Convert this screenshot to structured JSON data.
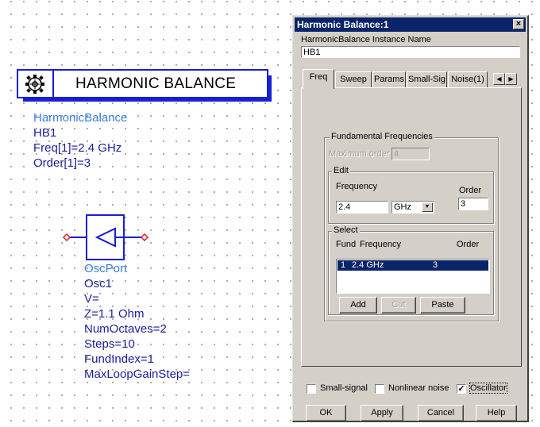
{
  "schematic": {
    "hb_title": "HARMONIC BALANCE",
    "hb_component": {
      "name": "HarmonicBalance",
      "params": [
        "HB1",
        "Freq[1]=2.4 GHz",
        "Order[1]=3"
      ]
    },
    "osc_component": {
      "name": "OscPort",
      "params": [
        "Osc1",
        "V=",
        "Z=1.1 Ohm",
        "NumOctaves=2",
        "Steps=10",
        "FundIndex=1",
        "MaxLoopGainStep="
      ]
    }
  },
  "dialog": {
    "title": "Harmonic Balance:1",
    "close_label": "×",
    "instance_label": "HarmonicBalance Instance Name",
    "instance_value": "HB1",
    "tabs": [
      "Freq",
      "Sweep",
      "Params",
      "Small-Sig",
      "Noise(1)"
    ],
    "fundamental_group": "Fundamental Frequencies",
    "max_order_label": "Maximum order",
    "max_order_value": "4",
    "edit_group": "Edit",
    "frequency_label": "Frequency",
    "order_label": "Order",
    "frequency_value": "2.4",
    "unit_value": "GHz",
    "order_value": "3",
    "select_group": "Select",
    "col_fund": "Fund",
    "col_frequency": "Frequency",
    "col_order": "Order",
    "list_row": {
      "fund": "1",
      "frequency": "2.4 GHz",
      "order": "3"
    },
    "add_label": "Add",
    "cut_label": "Cut",
    "paste_label": "Paste",
    "small_signal_label": "Small-signal",
    "nonlinear_noise_label": "Nonlinear noise",
    "oscillator_label": "Oscillator",
    "small_signal_checked": false,
    "nonlinear_noise_checked": false,
    "oscillator_checked": true,
    "ok_label": "OK",
    "apply_label": "Apply",
    "cancel_label": "Cancel",
    "help_label": "Help"
  },
  "colors": {
    "component_blue": "#1a1fd0",
    "name_blue": "#3a7be0",
    "param_blue": "#1a1f9a",
    "pin_red": "#e02020",
    "title_bar": "#0a246a"
  }
}
